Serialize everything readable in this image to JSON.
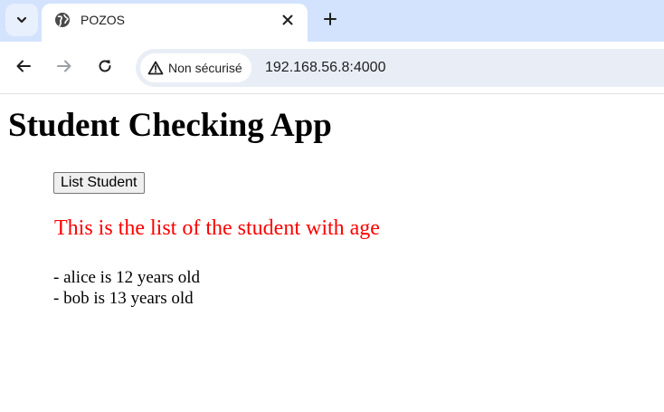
{
  "browser": {
    "tab": {
      "title": "POZOS",
      "favicon": "globe-icon"
    },
    "toolbar": {
      "security_label": "Non sécurisé",
      "url": "192.168.56.8:4000"
    }
  },
  "page": {
    "title": "Student Checking App",
    "button_label": "List Student",
    "list_heading": "This is the list of the student with age",
    "list_heading_color": "#ff0000",
    "students": [
      "- alice is 12 years old",
      "- bob is 13 years old"
    ]
  }
}
